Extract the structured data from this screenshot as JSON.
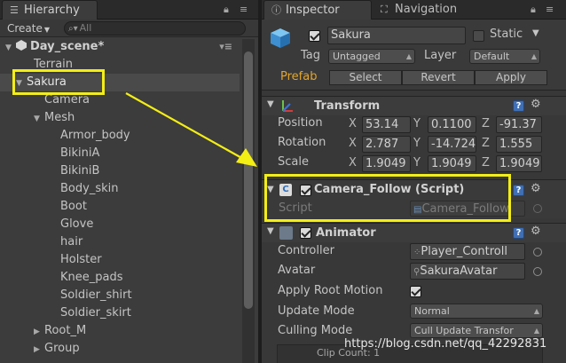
{
  "hierarchy": {
    "tab_label": "Hierarchy",
    "create_label": "Create",
    "search_placeholder": "All",
    "scene_name": "Day_scene*",
    "items": [
      {
        "label": "Terrain",
        "depth": 1,
        "toggle": ""
      },
      {
        "label": "Sakura",
        "depth": 0,
        "toggle": "expanded",
        "selected": true
      },
      {
        "label": "Camera",
        "depth": 2,
        "toggle": ""
      },
      {
        "label": "Mesh",
        "depth": 2,
        "toggle": "expanded"
      },
      {
        "label": "Armor_body",
        "depth": 3,
        "toggle": ""
      },
      {
        "label": "BikiniA",
        "depth": 3,
        "toggle": ""
      },
      {
        "label": "BikiniB",
        "depth": 3,
        "toggle": ""
      },
      {
        "label": "Body_skin",
        "depth": 3,
        "toggle": ""
      },
      {
        "label": "Boot",
        "depth": 3,
        "toggle": ""
      },
      {
        "label": "Glove",
        "depth": 3,
        "toggle": ""
      },
      {
        "label": "hair",
        "depth": 3,
        "toggle": ""
      },
      {
        "label": "Holster",
        "depth": 3,
        "toggle": ""
      },
      {
        "label": "Knee_pads",
        "depth": 3,
        "toggle": ""
      },
      {
        "label": "Soldier_shirt",
        "depth": 3,
        "toggle": ""
      },
      {
        "label": "Soldier_skirt",
        "depth": 3,
        "toggle": ""
      },
      {
        "label": "Root_M",
        "depth": 2,
        "toggle": "collapsed"
      },
      {
        "label": "Group",
        "depth": 2,
        "toggle": "collapsed"
      }
    ]
  },
  "inspector": {
    "tab_inspector": "Inspector",
    "tab_navigation": "Navigation",
    "object_name": "Sakura",
    "static_label": "Static",
    "tag_label": "Tag",
    "tag_value": "Untagged",
    "layer_label": "Layer",
    "layer_value": "Default",
    "prefab_label": "Prefab",
    "prefab_buttons": [
      "Select",
      "Revert",
      "Apply"
    ],
    "transform": {
      "title": "Transform",
      "rows": [
        {
          "label": "Position",
          "x": "53.14",
          "y": "0.1100",
          "z": "-91.37"
        },
        {
          "label": "Rotation",
          "x": "2.787",
          "y": "-14.724",
          "z": "1.555"
        },
        {
          "label": "Scale",
          "x": "1.9049",
          "y": "1.9049",
          "z": "1.9049"
        }
      ]
    },
    "camera_follow": {
      "title": "Camera_Follow (Script)",
      "script_label": "Script",
      "script_value": "Camera_Follow"
    },
    "animator": {
      "title": "Animator",
      "controller_label": "Controller",
      "controller_value": "Player_Controll",
      "avatar_label": "Avatar",
      "avatar_value": "SakuraAvatar",
      "apply_root_motion_label": "Apply Root Motion",
      "update_mode_label": "Update Mode",
      "update_mode_value": "Normal",
      "culling_mode_label": "Culling Mode",
      "culling_mode_value": "Cull Update Transfor",
      "clip_count": "Clip Count: 1"
    }
  },
  "watermark": "https://blog.csdn.net/qq_42292831",
  "colors": {
    "highlight": "#f3ee14",
    "prefab_orange": "#e3a52a",
    "panel_bg": "#383838",
    "tab_bg": "#2a2a2a"
  }
}
